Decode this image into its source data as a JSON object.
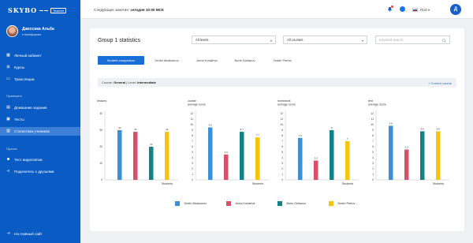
{
  "sidebar": {
    "logo": "SKYBO",
    "logo_badge": "Teacher",
    "profile": {
      "name": "Джессика Альба",
      "city": "● Калифорния"
    },
    "items": [
      {
        "label": "Личный кабинет",
        "icon": "grid-icon"
      },
      {
        "label": "Курсы",
        "icon": "courses-icon"
      },
      {
        "label": "Трансляции",
        "icon": "broadcast-icon"
      }
    ],
    "section_check": "Проверить",
    "check_items": [
      {
        "label": "Домашние задания",
        "icon": "homework-icon"
      },
      {
        "label": "Тесты",
        "icon": "tests-icon"
      },
      {
        "label": "Статистика учеников",
        "icon": "stats-icon"
      }
    ],
    "section_other": "Прочее",
    "other_items": [
      {
        "label": "Тест видеосвязи",
        "icon": "camera-icon"
      },
      {
        "label": "Поделитесь с друзьями",
        "icon": "share-icon"
      }
    ],
    "back_to_site": "На главный сайт"
  },
  "topbar": {
    "next_lesson_label": "Следующее занятие:",
    "next_lesson_value": "сегодня 10:00 МСК",
    "language": "RUS",
    "user_initial": "Д"
  },
  "card": {
    "title": "Group 1 statistics",
    "level_select": "All levels",
    "course_select": "All courses",
    "search_placeholder": "Keyword search",
    "tabs": [
      "Student comparison",
      "Dmitri Abakumov",
      "Anna Koraleva",
      "Boris Golianov",
      "Dmitri Petrov"
    ],
    "course_label": "Course:",
    "course_value": "General",
    "level_label": "Level:",
    "level_value": "Intermediate",
    "current_course": "Current course"
  },
  "colors": {
    "dmitri_abakumov": "#3a8fd6",
    "anna_koraleva": "#d9506a",
    "boris_golianov": "#128287",
    "dmitri_petrov": "#f6c40a"
  },
  "chart_data": [
    {
      "type": "bar",
      "ylabel": "lessons",
      "xlabel": "Students",
      "ylim": [
        0,
        40
      ],
      "yticks": [
        0,
        10,
        20,
        30,
        40
      ],
      "categories": [
        "Dmitri Abakumov",
        "Anna Koraleva",
        "Boris Golianov",
        "Dmitri Petrov"
      ],
      "values": [
        30,
        29,
        20,
        29
      ]
    },
    {
      "type": "bar",
      "ylabel": "course\naverage score",
      "xlabel": "Students",
      "ylim": [
        0,
        12
      ],
      "yticks": [
        0,
        1,
        2,
        3,
        4,
        5,
        6,
        7,
        8,
        9,
        10,
        11,
        12
      ],
      "categories": [
        "Dmitri Abakumov",
        "Anna Koraleva",
        "Boris Golianov",
        "Dmitri Petrov"
      ],
      "values": [
        9.5,
        4.6,
        8.7,
        7.7
      ]
    },
    {
      "type": "bar",
      "ylabel": "homework\naverage score",
      "xlabel": "Students",
      "ylim": [
        0,
        12
      ],
      "yticks": [
        0,
        1,
        2,
        3,
        4,
        5,
        6,
        7,
        8,
        9,
        10,
        11,
        12
      ],
      "categories": [
        "Dmitri Abakumov",
        "Anna Koraleva",
        "Boris Golianov",
        "Dmitri Petrov"
      ],
      "values": [
        7.6,
        3.5,
        9,
        7
      ]
    },
    {
      "type": "bar",
      "ylabel": "test\naverage score",
      "xlabel": "Students",
      "ylim": [
        0,
        12
      ],
      "yticks": [
        0,
        1,
        2,
        3,
        4,
        5,
        6,
        7,
        8,
        9,
        10,
        11,
        12
      ],
      "categories": [
        "Dmitri Abakumov",
        "Anna Koraleva",
        "Boris Golianov",
        "Dmitri Petrov"
      ],
      "values": [
        9.8,
        5.5,
        8.8,
        8.8
      ]
    }
  ],
  "legend": [
    "Dmitri Abakumov",
    "Anna Koraleva",
    "Boris Golianov",
    "Dmitri Petrov"
  ]
}
